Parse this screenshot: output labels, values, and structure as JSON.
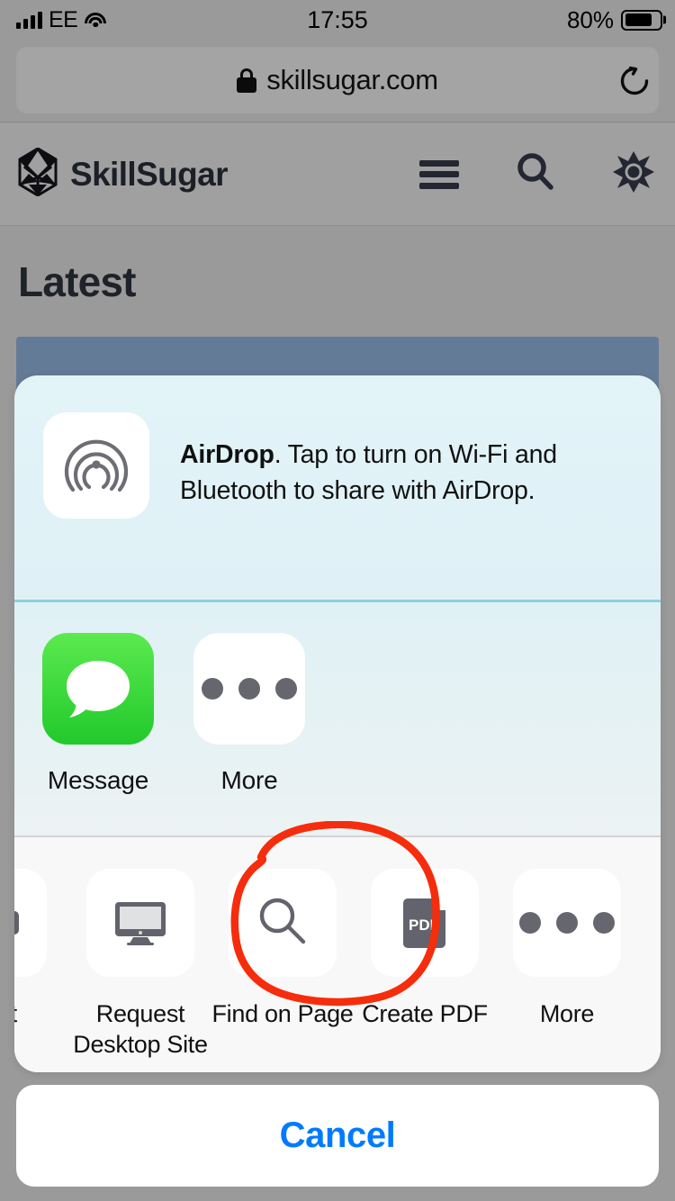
{
  "status_bar": {
    "carrier": "EE",
    "time": "17:55",
    "battery_percent": "80%",
    "signal_icon": "signal-bars-icon",
    "wifi_icon": "wifi-icon",
    "battery_icon": "battery-icon"
  },
  "browser": {
    "url": "skillsugar.com",
    "lock_icon": "lock-icon",
    "reload_icon": "reload-icon"
  },
  "site_header": {
    "brand": "SkillSugar",
    "logo_icon": "icosahedron-logo-icon",
    "menu_icon": "hamburger-menu-icon",
    "search_icon": "search-icon",
    "theme_icon": "sun-brightness-icon"
  },
  "page": {
    "heading": "Latest"
  },
  "share_sheet": {
    "airdrop": {
      "icon": "airdrop-icon",
      "title": "AirDrop",
      "message": ". Tap to turn on Wi-Fi and Bluetooth to share with AirDrop."
    },
    "apps": [
      {
        "label": "Message",
        "icon": "messages-app-icon"
      },
      {
        "label": "More",
        "icon": "more-dots-icon"
      }
    ],
    "actions": [
      {
        "label": "Print",
        "icon": "printer-icon",
        "clipped": "true"
      },
      {
        "label": "Request\nDesktop Site",
        "icon": "desktop-monitor-icon"
      },
      {
        "label": "Find on Page",
        "icon": "magnifier-icon"
      },
      {
        "label": "Create PDF",
        "icon": "pdf-document-icon"
      },
      {
        "label": "More",
        "icon": "more-dots-icon"
      }
    ],
    "cancel_label": "Cancel"
  },
  "annotation": {
    "shape": "hand-drawn-circle",
    "target": "Find on Page",
    "color": "#f52d0c"
  },
  "colors": {
    "accent_blue": "#017aff",
    "annotation_red": "#f52d0c",
    "sheet_bg": "#e2f4f8",
    "hero_blue": "#647b98",
    "backdrop_gray": "#9a9a9a"
  }
}
